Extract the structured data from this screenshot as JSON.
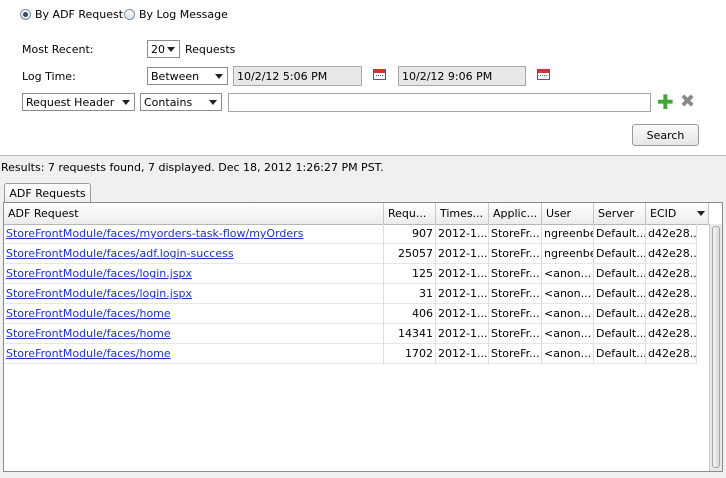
{
  "search_mode": {
    "options": [
      {
        "label": "By ADF Request",
        "selected": true
      },
      {
        "label": "By Log Message",
        "selected": false
      }
    ]
  },
  "filters": {
    "most_recent_label": "Most Recent:",
    "most_recent_value": "20",
    "most_recent_unit": "Requests",
    "log_time_label": "Log Time:",
    "log_time_operator": "Between",
    "log_time_from": "10/2/12 5:06 PM",
    "log_time_to": "10/2/12 9:06 PM",
    "field_select": "Request Header",
    "condition_select": "Contains",
    "condition_value": ""
  },
  "search_button": "Search",
  "results_summary": "Results:  7 requests found, 7 displayed.  Dec 18, 2012 1:26:27 PM PST.",
  "tab_label": "ADF Requests",
  "table": {
    "columns": [
      "ADF Request",
      "Requ...",
      "Times...",
      "Applic...",
      "User",
      "Server",
      "ECID"
    ],
    "rows": [
      [
        "StoreFrontModule/faces/myorders-task-flow/myOrders",
        "907",
        "2012-1...",
        "StoreFr...",
        "ngreenbe",
        "Default...",
        "d42e28..."
      ],
      [
        "StoreFrontModule/faces/adf.login-success",
        "25057",
        "2012-1...",
        "StoreFr...",
        "ngreenbe",
        "Default...",
        "d42e28..."
      ],
      [
        "StoreFrontModule/faces/login.jspx",
        "125",
        "2012-1...",
        "StoreFr...",
        "<anon...",
        "Default...",
        "d42e28..."
      ],
      [
        "StoreFrontModule/faces/login.jspx",
        "31",
        "2012-1...",
        "StoreFr...",
        "<anon...",
        "Default...",
        "d42e28..."
      ],
      [
        "StoreFrontModule/faces/home",
        "406",
        "2012-1...",
        "StoreFr...",
        "<anon...",
        "Default...",
        "d42e28..."
      ],
      [
        "StoreFrontModule/faces/home",
        "14341",
        "2012-1...",
        "StoreFr...",
        "<anon...",
        "Default...",
        "d42e28..."
      ],
      [
        "StoreFrontModule/faces/home",
        "1702",
        "2012-1...",
        "StoreFr...",
        "<anon...",
        "Default...",
        "d42e28..."
      ]
    ]
  },
  "icons": {
    "calendar": "calendar-icon",
    "add": "add-icon",
    "remove": "remove-icon"
  }
}
